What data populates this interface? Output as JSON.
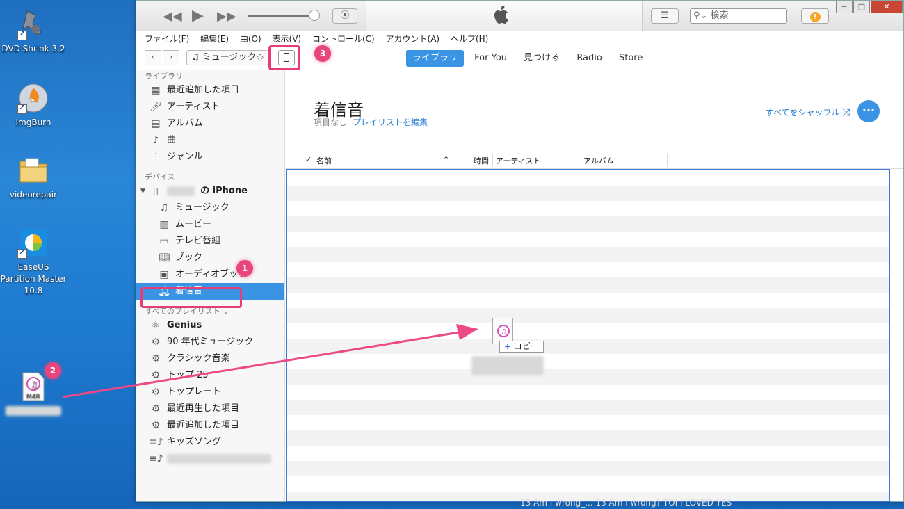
{
  "desktop": {
    "icons": [
      {
        "label": "DVD Shrink 3.2"
      },
      {
        "label": "ImgBurn"
      },
      {
        "label": "videorepair"
      },
      {
        "label": "EaseUS Partition Master 10.8"
      },
      {
        "label": "M4R"
      }
    ]
  },
  "titlebar": {
    "search_placeholder": "検索",
    "window_controls": [
      "─",
      "□",
      "✕"
    ]
  },
  "menubar": [
    "ファイル(F)",
    "編集(E)",
    "曲(O)",
    "表示(V)",
    "コントロール(C)",
    "アカウント(A)",
    "ヘルプ(H)"
  ],
  "nav": {
    "back": "‹",
    "forward": "›",
    "media_selector": "ミュージック",
    "tabs": [
      "ライブラリ",
      "For You",
      "見つける",
      "Radio",
      "Store"
    ],
    "active_tab": "ライブラリ"
  },
  "sidebar": {
    "library_header": "ライブラリ",
    "library": [
      {
        "label": "最近追加した項目",
        "icon": "grid-icon"
      },
      {
        "label": "アーティスト",
        "icon": "microphone-icon"
      },
      {
        "label": "アルバム",
        "icon": "album-icon"
      },
      {
        "label": "曲",
        "icon": "note-icon"
      },
      {
        "label": "ジャンル",
        "icon": "genre-icon"
      }
    ],
    "devices_header": "デバイス",
    "device_name_suffix": "の iPhone",
    "device_items": [
      {
        "label": "ミュージック"
      },
      {
        "label": "ムービー"
      },
      {
        "label": "テレビ番組"
      },
      {
        "label": "ブック"
      },
      {
        "label": "オーディオブック"
      },
      {
        "label": "着信音"
      }
    ],
    "selected": "着信音",
    "playlists_header": "すべてのプレイリスト",
    "playlists": [
      {
        "label": "Genius"
      },
      {
        "label": "90 年代ミュージック"
      },
      {
        "label": "クラシック音楽"
      },
      {
        "label": "トップ 25"
      },
      {
        "label": "トップレート"
      },
      {
        "label": "最近再生した項目"
      },
      {
        "label": "最近追加した項目"
      },
      {
        "label": "キッズソング"
      }
    ]
  },
  "main": {
    "title": "着信音",
    "subtitle": "項目なし",
    "edit_playlist": "プレイリストを編集",
    "shuffle_all": "すべてをシャッフル",
    "columns": {
      "check": "✓",
      "name": "名前",
      "time": "時間",
      "artist": "アーティスト",
      "album": "アルバム"
    }
  },
  "drag": {
    "copy_label": "コピー",
    "plus": "+"
  },
  "annotations": {
    "one": "1",
    "two": "2",
    "three": "3"
  },
  "taskbar_text": "13 Am I wrong_... 13   Am I wrong?   TOI   I LOVED YES",
  "colors": {
    "accent": "#3b93e3",
    "highlight": "#e63c78",
    "desktop": "#1f6fc0"
  }
}
